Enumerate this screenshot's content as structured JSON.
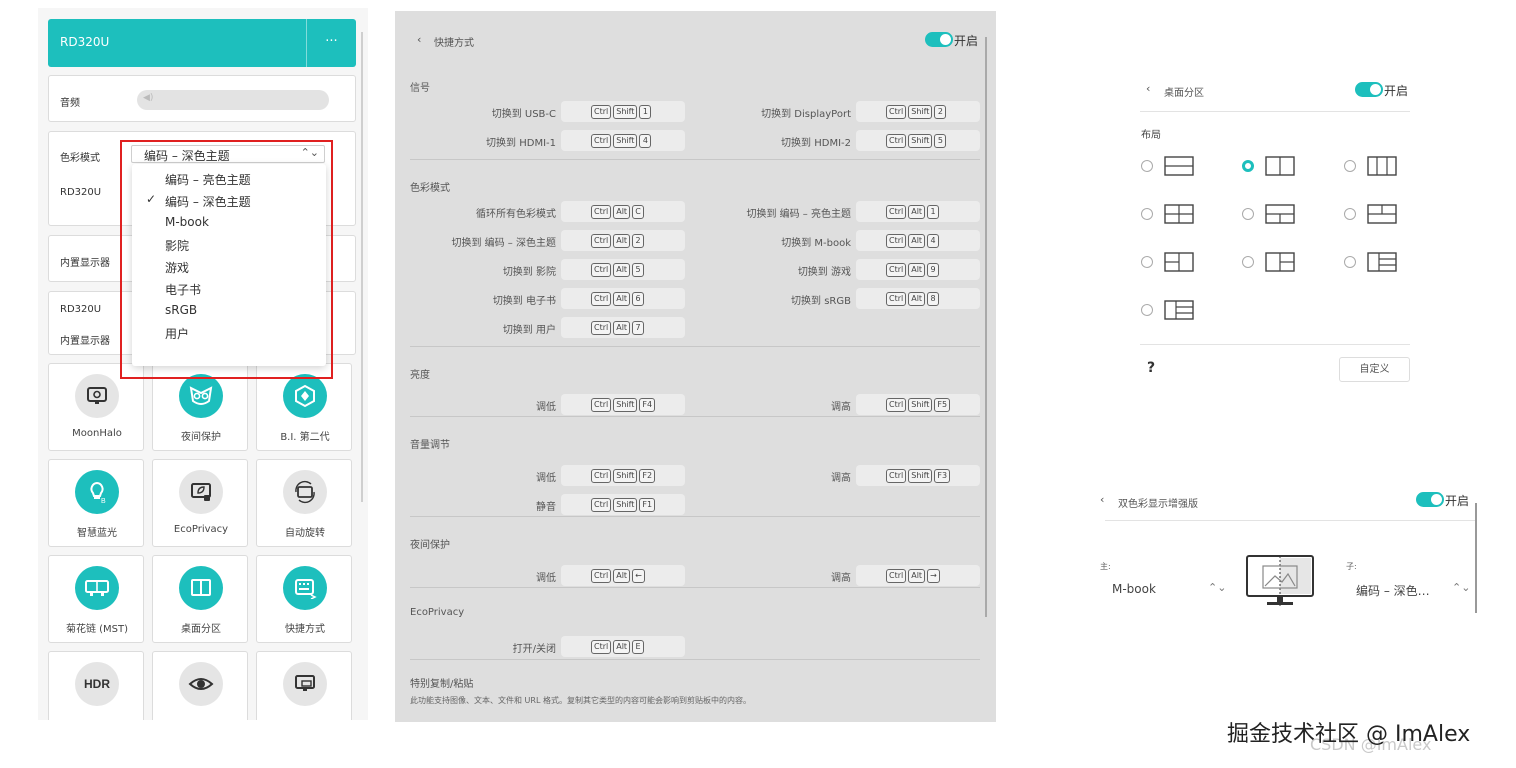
{
  "device_panel": {
    "title": "RD320U",
    "more_label": "···",
    "volume_label": "音频",
    "color_mode_label": "色彩模式",
    "color_mode_value": "编码 – 深色主题",
    "device_label": "RD320U",
    "builtin_display_label": "内置显示器",
    "device_label_2": "RD320U",
    "builtin_display_label_2": "内置显示器",
    "dropdown_options": [
      {
        "label": "编码 – 亮色主题",
        "checked": false
      },
      {
        "label": "编码 – 深色主题",
        "checked": true
      },
      {
        "label": "M-book",
        "checked": false
      },
      {
        "label": "影院",
        "checked": false
      },
      {
        "label": "游戏",
        "checked": false
      },
      {
        "label": "电子书",
        "checked": false
      },
      {
        "label": "sRGB",
        "checked": false
      },
      {
        "label": "用户",
        "checked": false
      }
    ],
    "tiles": [
      {
        "label": "MoonHalo",
        "icon": "moonhalo-icon"
      },
      {
        "label": "夜间保护",
        "icon": "owl-icon"
      },
      {
        "label": "B.I. 第二代",
        "icon": "bi-icon"
      },
      {
        "label": "智慧蓝光",
        "icon": "bulb-icon"
      },
      {
        "label": "EcoPrivacy",
        "icon": "privacy-icon"
      },
      {
        "label": "自动旋转",
        "icon": "rotate-icon"
      },
      {
        "label": "菊花链 (MST)",
        "icon": "daisy-chain-icon"
      },
      {
        "label": "桌面分区",
        "icon": "partition-icon"
      },
      {
        "label": "快捷方式",
        "icon": "keyboard-icon"
      },
      {
        "label": "",
        "icon": "hdr-icon",
        "text": "HDR"
      },
      {
        "label": "",
        "icon": "eye-icon"
      },
      {
        "label": "",
        "icon": "monitor-icon"
      }
    ]
  },
  "shortcuts_panel": {
    "back": "‹",
    "title": "快捷方式",
    "toggle_label": "开启",
    "sections": [
      {
        "title": "信号",
        "rows": [
          {
            "left": {
              "label": "切换到 USB-C",
              "keys": [
                "Ctrl",
                "Shift",
                "1"
              ]
            },
            "right": {
              "label": "切换到 DisplayPort",
              "keys": [
                "Ctrl",
                "Shift",
                "2"
              ]
            }
          },
          {
            "left": {
              "label": "切换到 HDMI-1",
              "keys": [
                "Ctrl",
                "Shift",
                "4"
              ]
            },
            "right": {
              "label": "切换到 HDMI-2",
              "keys": [
                "Ctrl",
                "Shift",
                "5"
              ]
            }
          }
        ]
      },
      {
        "title": "色彩模式",
        "rows": [
          {
            "left": {
              "label": "循环所有色彩模式",
              "keys": [
                "Ctrl",
                "Alt",
                "C"
              ]
            },
            "right": {
              "label": "切换到 编码 – 亮色主题",
              "keys": [
                "Ctrl",
                "Alt",
                "1"
              ]
            }
          },
          {
            "left": {
              "label": "切换到 编码 – 深色主题",
              "keys": [
                "Ctrl",
                "Alt",
                "2"
              ]
            },
            "right": {
              "label": "切换到 M-book",
              "keys": [
                "Ctrl",
                "Alt",
                "4"
              ]
            }
          },
          {
            "left": {
              "label": "切换到 影院",
              "keys": [
                "Ctrl",
                "Alt",
                "5"
              ]
            },
            "right": {
              "label": "切换到 游戏",
              "keys": [
                "Ctrl",
                "Alt",
                "9"
              ]
            }
          },
          {
            "left": {
              "label": "切换到 电子书",
              "keys": [
                "Ctrl",
                "Alt",
                "6"
              ]
            },
            "right": {
              "label": "切换到 sRGB",
              "keys": [
                "Ctrl",
                "Alt",
                "8"
              ]
            }
          },
          {
            "left": {
              "label": "切换到 用户",
              "keys": [
                "Ctrl",
                "Alt",
                "7"
              ]
            },
            "right": null
          }
        ]
      },
      {
        "title": "亮度",
        "rows": [
          {
            "left": {
              "label": "调低",
              "keys": [
                "Ctrl",
                "Shift",
                "F4"
              ]
            },
            "right": {
              "label": "调高",
              "keys": [
                "Ctrl",
                "Shift",
                "F5"
              ]
            }
          }
        ]
      },
      {
        "title": "音量调节",
        "rows": [
          {
            "left": {
              "label": "调低",
              "keys": [
                "Ctrl",
                "Shift",
                "F2"
              ]
            },
            "right": {
              "label": "调高",
              "keys": [
                "Ctrl",
                "Shift",
                "F3"
              ]
            }
          },
          {
            "left": {
              "label": "静音",
              "keys": [
                "Ctrl",
                "Shift",
                "F1"
              ]
            },
            "right": null
          }
        ]
      },
      {
        "title": "夜间保护",
        "rows": [
          {
            "left": {
              "label": "调低",
              "keys": [
                "Ctrl",
                "Alt",
                "←"
              ]
            },
            "right": {
              "label": "调高",
              "keys": [
                "Ctrl",
                "Alt",
                "→"
              ]
            }
          }
        ]
      },
      {
        "title": "EcoPrivacy",
        "rows": [
          {
            "left": {
              "label": "打开/关闭",
              "keys": [
                "Ctrl",
                "Alt",
                "E"
              ]
            },
            "right": null
          }
        ]
      }
    ],
    "special_title": "特别复制/粘贴",
    "special_note": "此功能支持图像、文本、文件和 URL 格式。复制其它类型的内容可能会影响到剪贴板中的内容。"
  },
  "partition_panel": {
    "back": "‹",
    "title": "桌面分区",
    "toggle_label": "开启",
    "layout_label": "布局",
    "help": "?",
    "custom_label": "自定义",
    "selected_index": 1
  },
  "dual_color_panel": {
    "back": "‹",
    "title": "双色彩显示增强版",
    "toggle_label": "开启",
    "main_label": "主:",
    "main_value": "M-book",
    "sub_label": "子:",
    "sub_value": "编码 – 深色…"
  },
  "watermark": {
    "line1": "掘金技术社区 @ ImAlex",
    "line2": "CSDN @ImAlex"
  },
  "colors": {
    "accent": "#1dbfbd",
    "highlight_box": "#e02020"
  }
}
